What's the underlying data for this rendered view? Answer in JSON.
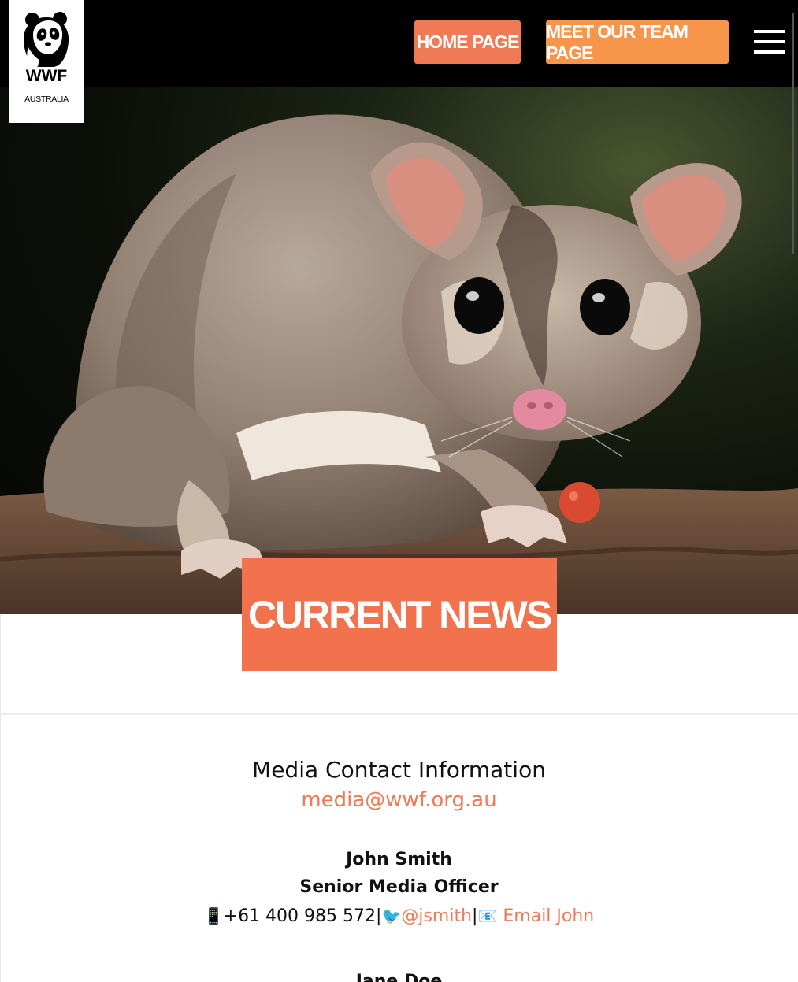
{
  "logo": {
    "brand": "WWF",
    "country": "AUSTRALIA"
  },
  "nav": {
    "home": "HOME PAGE",
    "team": "MEET OUR TEAM PAGE"
  },
  "hero": {
    "banner": "CURRENT NEWS"
  },
  "contact": {
    "heading": "Media Contact Information",
    "email": "media@wwf.org.au",
    "person": {
      "name": "John Smith",
      "role": "Senior Media Officer",
      "phone_icon": "📱",
      "phone": "+61 400 985 572",
      "sep": "|",
      "twitter_icon": "🐦",
      "twitter": "@jsmith",
      "email_icon": "📧",
      "email_link": "Email John"
    },
    "next_name": "Jane Doe"
  },
  "colors": {
    "accent": "#f07a55",
    "accent_alt": "#f7964a",
    "banner": "#f2724d"
  }
}
